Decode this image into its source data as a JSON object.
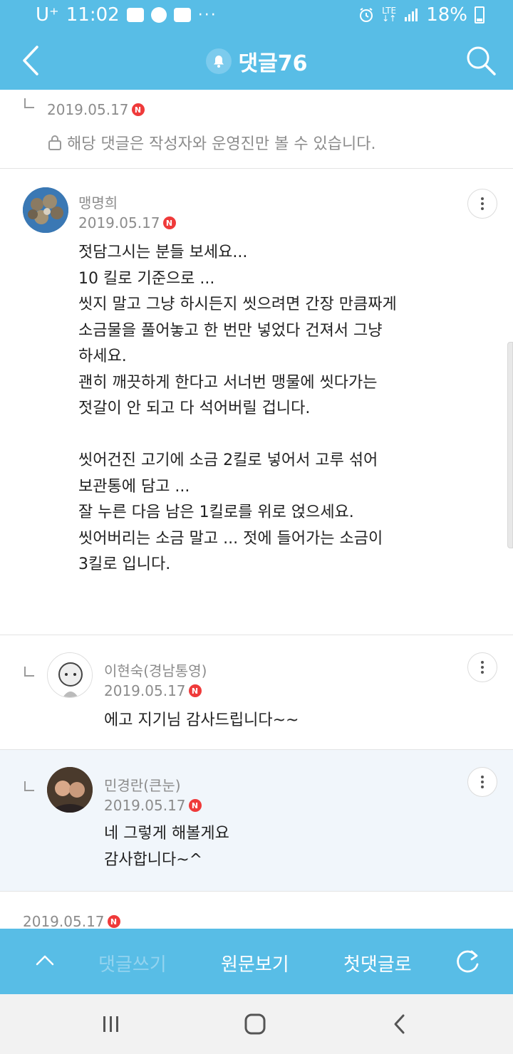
{
  "status_bar": {
    "carrier": "U⁺",
    "time": "11:02",
    "extra_icons": [
      "youtube-icon",
      "app-icon",
      "app-icon"
    ],
    "more": "···",
    "lte": "LTE",
    "battery": "18%"
  },
  "header": {
    "title": "댓글76"
  },
  "comments": {
    "private_reply": {
      "date": "2019.05.17",
      "text": "해당 댓글은 작성자와 운영진만 볼 수 있습니다."
    },
    "main": {
      "author": "맹명희",
      "date": "2019.05.17",
      "body": "젓담그시는 분들 보세요...\n10 킬로 기준으로 ...\n씻지 말고 그냥 하시든지 씻으려면 간장 만큼짜게\n소금물을 풀어놓고 한 번만 넣었다 건져서 그냥\n하세요.\n괜히 깨끗하게 한다고 서너번 맹물에 씻다가는\n젓갈이 안 되고 다 석어버릴 겁니다.\n\n씻어건진 고기에 소금 2킬로 넣어서 고루 섞어\n보관통에 담고 ...\n잘 누른 다음 남은 1킬로를 위로 얹으세요.\n씻어버리는 소금 말고 ... 젓에 들어가는 소금이\n3킬로 입니다."
    },
    "reply1": {
      "author": "이현숙(경남통영)",
      "date": "2019.05.17",
      "body": "에고 지기님 감사드립니다~~"
    },
    "reply2": {
      "author": "민경란(큰눈)",
      "date": "2019.05.17",
      "body": "네 그렇게 해볼게요\n감사합니다~^"
    },
    "next": {
      "date": "2019.05.17"
    },
    "new_badge": "N"
  },
  "bottom_bar": {
    "write": "댓글쓰기",
    "original": "원문보기",
    "first": "첫댓글로"
  },
  "colors": {
    "accent": "#58bde6",
    "new_badge": "#ef3a3a",
    "highlight_bg": "#f1f6fb"
  }
}
